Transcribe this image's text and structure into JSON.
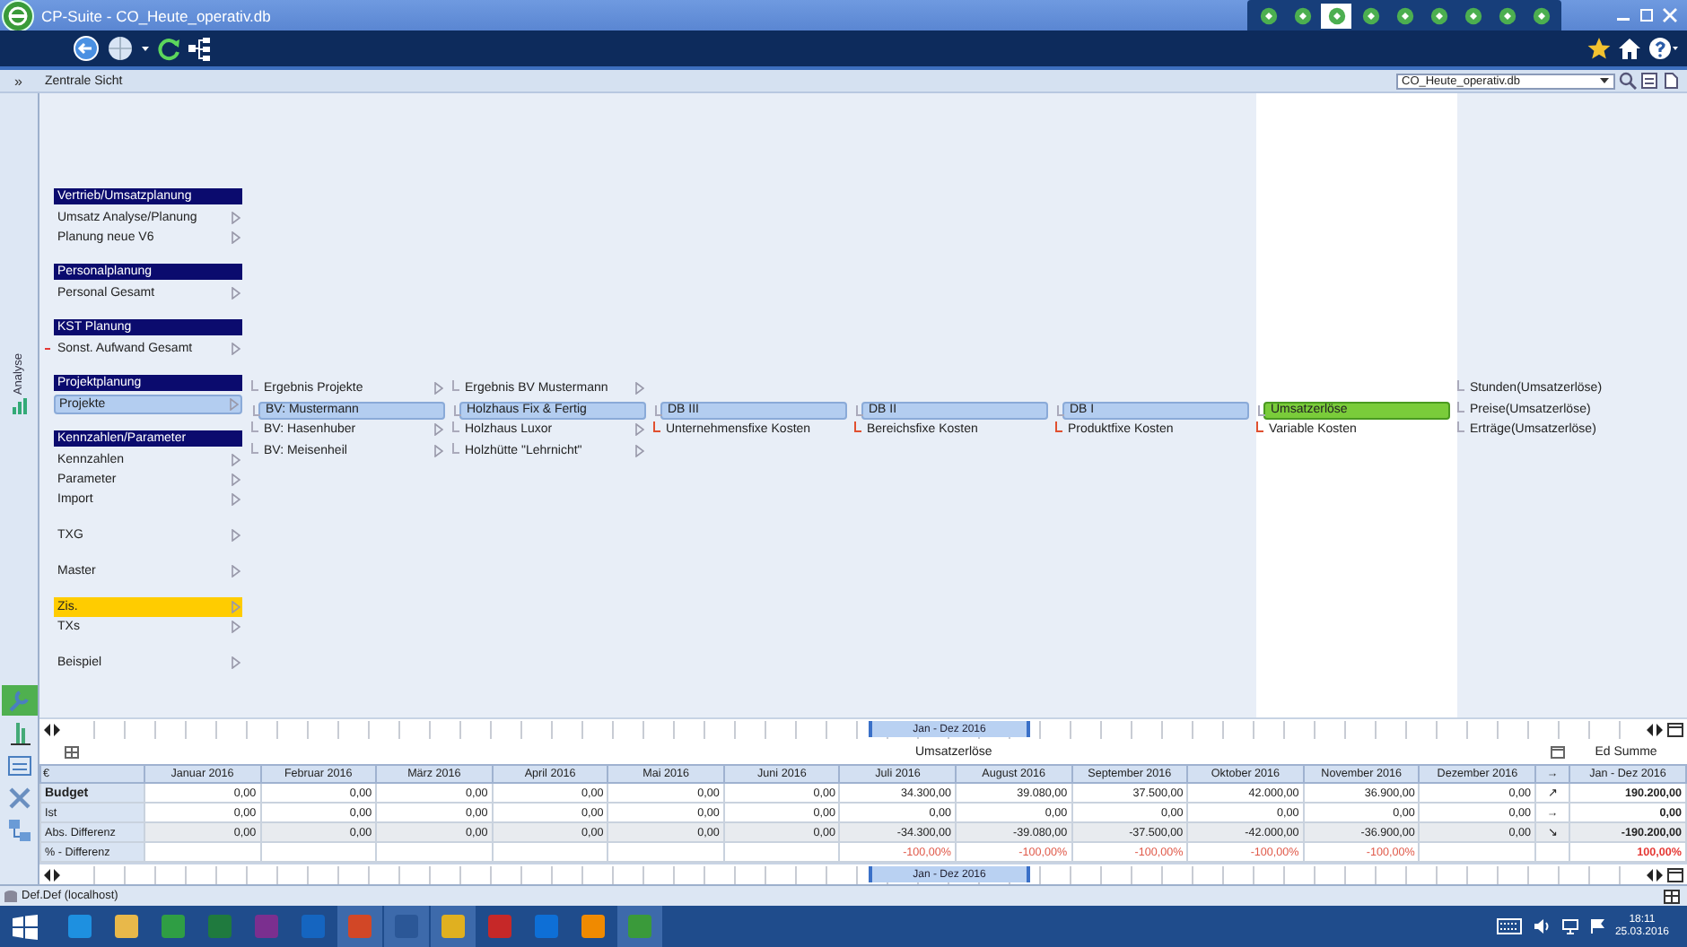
{
  "window": {
    "title": "CP-Suite - CO_Heute_operativ.db"
  },
  "modules": [
    {
      "selected": false
    },
    {
      "selected": false
    },
    {
      "selected": true
    },
    {
      "selected": false
    },
    {
      "selected": false
    },
    {
      "selected": false
    },
    {
      "selected": false
    },
    {
      "selected": false
    },
    {
      "selected": false
    }
  ],
  "view_header": {
    "collapse_glyph": "»",
    "title": "Zentrale Sicht",
    "database": "CO_Heute_operativ.db"
  },
  "sidebar": {
    "label": "Analyse",
    "tools": [
      {
        "selected": true
      },
      {
        "selected": false
      },
      {
        "selected": false
      },
      {
        "selected": false
      },
      {
        "selected": false
      }
    ]
  },
  "menu_groups": [
    {
      "heading": "Vertrieb/Umsatzplanung",
      "items": [
        {
          "label": "Umsatz Analyse/Planung",
          "selected": false,
          "highlighted": false,
          "flagged": false
        },
        {
          "label": "Planung neue V6",
          "selected": false,
          "highlighted": false,
          "flagged": false
        }
      ]
    },
    {
      "heading": "Personalplanung",
      "items": [
        {
          "label": "Personal Gesamt",
          "selected": false,
          "highlighted": false,
          "flagged": false
        }
      ]
    },
    {
      "heading": "KST Planung",
      "items": [
        {
          "label": "Sonst. Aufwand Gesamt",
          "selected": false,
          "highlighted": false,
          "flagged": true
        }
      ]
    },
    {
      "heading": "Projektplanung",
      "items": [
        {
          "label": "Projekte",
          "selected": true,
          "highlighted": false,
          "flagged": false
        }
      ]
    },
    {
      "heading": "Kennzahlen/Parameter",
      "items": [
        {
          "label": "Kennzahlen",
          "selected": false,
          "highlighted": false,
          "flagged": false
        },
        {
          "label": "Parameter",
          "selected": false,
          "highlighted": false,
          "flagged": false
        },
        {
          "label": "Import",
          "selected": false,
          "highlighted": false,
          "flagged": false
        }
      ]
    },
    {
      "items": [
        {
          "label": "TXG",
          "selected": false,
          "highlighted": false,
          "flagged": false
        }
      ]
    },
    {
      "items": [
        {
          "label": "Master",
          "selected": false,
          "highlighted": false,
          "flagged": false
        }
      ]
    },
    {
      "items": [
        {
          "label": "Zis.",
          "selected": false,
          "highlighted": true,
          "flagged": false
        },
        {
          "label": "TXs",
          "selected": false,
          "highlighted": false,
          "flagged": false
        }
      ]
    },
    {
      "items": [
        {
          "label": "Beispiel",
          "selected": false,
          "highlighted": false,
          "flagged": false
        }
      ]
    }
  ],
  "tree_columns": [
    {
      "focused": false,
      "items": [
        {
          "label": "Ergebnis Projekte",
          "kind": "branch",
          "selected": false
        },
        {
          "label": "BV: Mustermann",
          "kind": "branch",
          "selected": true
        },
        {
          "label": "BV: Hasenhuber",
          "kind": "branch",
          "selected": false
        },
        {
          "label": "BV: Meisenheil",
          "kind": "branch",
          "selected": false
        }
      ]
    },
    {
      "focused": false,
      "items": [
        {
          "label": "Ergebnis BV Mustermann",
          "kind": "branch",
          "selected": false
        },
        {
          "label": "Holzhaus Fix & Fertig",
          "kind": "branch",
          "selected": true
        },
        {
          "label": "Holzhaus Luxor",
          "kind": "branch",
          "selected": false
        },
        {
          "label": "Holzhütte \"Lehrnicht\"",
          "kind": "branch",
          "selected": false
        }
      ]
    },
    {
      "focused": false,
      "items": [
        {
          "label": "DB III",
          "kind": "branch",
          "selected": true
        },
        {
          "label": "Unternehmensfixe Kosten",
          "kind": "cost",
          "selected": false
        }
      ]
    },
    {
      "focused": false,
      "items": [
        {
          "label": "DB II",
          "kind": "branch",
          "selected": true
        },
        {
          "label": "Bereichsfixe Kosten",
          "kind": "cost",
          "selected": false
        }
      ]
    },
    {
      "focused": false,
      "items": [
        {
          "label": "DB I",
          "kind": "branch",
          "selected": true
        },
        {
          "label": "Produktfixe Kosten",
          "kind": "cost",
          "selected": false
        }
      ]
    },
    {
      "focused": true,
      "items": [
        {
          "label": "Umsatzerlöse",
          "kind": "branch",
          "selected": true
        },
        {
          "label": "Variable Kosten",
          "kind": "cost",
          "selected": false
        }
      ]
    },
    {
      "focused": false,
      "items": [
        {
          "label": "Stunden(Umsatzerlöse)",
          "kind": "plain",
          "selected": false
        },
        {
          "label": "Preise(Umsatzerlöse)",
          "kind": "plain",
          "selected": false
        },
        {
          "label": "Erträge(Umsatzerlöse)",
          "kind": "plain",
          "selected": false
        }
      ]
    }
  ],
  "timeline_top": {
    "range": "Jan - Dez 2016"
  },
  "table": {
    "title": "Umsatzerlöse",
    "summary_mode": "Ed Summe",
    "corner": "€",
    "trend_header": "→",
    "total_header": "Jan - Dez 2016",
    "months": [
      {
        "label": "Januar 2016",
        "budget": "0,00",
        "actual": "0,00",
        "difference": "0,00"
      },
      {
        "label": "Februar 2016",
        "budget": "0,00",
        "actual": "0,00",
        "difference": "0,00"
      },
      {
        "label": "März 2016",
        "budget": "0,00",
        "actual": "0,00",
        "difference": "0,00"
      },
      {
        "label": "April 2016",
        "budget": "0,00",
        "actual": "0,00",
        "difference": "0,00"
      },
      {
        "label": "Mai 2016",
        "budget": "0,00",
        "actual": "0,00",
        "difference": "0,00"
      },
      {
        "label": "Juni 2016",
        "budget": "0,00",
        "actual": "0,00",
        "difference": "0,00"
      },
      {
        "label": "Juli 2016",
        "budget": "34.300,00",
        "actual": "0,00",
        "difference": "-34.300,00",
        "percent": "-100,00%"
      },
      {
        "label": "August 2016",
        "budget": "39.080,00",
        "actual": "0,00",
        "difference": "-39.080,00",
        "percent": "-100,00%"
      },
      {
        "label": "September 2016",
        "budget": "37.500,00",
        "actual": "0,00",
        "difference": "-37.500,00",
        "percent": "-100,00%"
      },
      {
        "label": "Oktober 2016",
        "budget": "42.000,00",
        "actual": "0,00",
        "difference": "-42.000,00",
        "percent": "-100,00%"
      },
      {
        "label": "November 2016",
        "budget": "36.900,00",
        "actual": "0,00",
        "difference": "-36.900,00",
        "percent": "-100,00%"
      },
      {
        "label": "Dezember 2016",
        "budget": "0,00",
        "actual": "0,00",
        "difference": "0,00"
      }
    ],
    "rows": [
      {
        "label": "Budget",
        "kind": "budget",
        "trend": "↗",
        "total": "190.200,00"
      },
      {
        "label": "Ist",
        "kind": "actual",
        "trend": "→",
        "total": "0,00"
      },
      {
        "label": "Abs. Differenz",
        "kind": "difference",
        "trend": "↘",
        "total": "-190.200,00"
      },
      {
        "label": "% - Differenz",
        "kind": "percent",
        "total": "100,00%"
      }
    ]
  },
  "timeline_bottom": {
    "range": "Jan - Dez 2016"
  },
  "status_bar": {
    "connection": "Def.Def (localhost)"
  },
  "taskbar": {
    "apps": [
      {
        "color": "#1e90e0",
        "running": false
      },
      {
        "color": "#e8b84a",
        "running": false
      },
      {
        "color": "#2f9e44",
        "running": false
      },
      {
        "color": "#1f7a3e",
        "running": false
      },
      {
        "color": "#7b2f8f",
        "running": false
      },
      {
        "color": "#1565c0",
        "running": false
      },
      {
        "color": "#d24726",
        "running": true
      },
      {
        "color": "#2b5797",
        "running": true
      },
      {
        "color": "#e0b020",
        "running": true
      },
      {
        "color": "#c62828",
        "running": false
      },
      {
        "color": "#0e6fd6",
        "running": false
      },
      {
        "color": "#f08a00",
        "running": false
      },
      {
        "color": "#3a9a3a",
        "running": true
      }
    ],
    "time": "18:11",
    "date": "25.03.2016"
  }
}
